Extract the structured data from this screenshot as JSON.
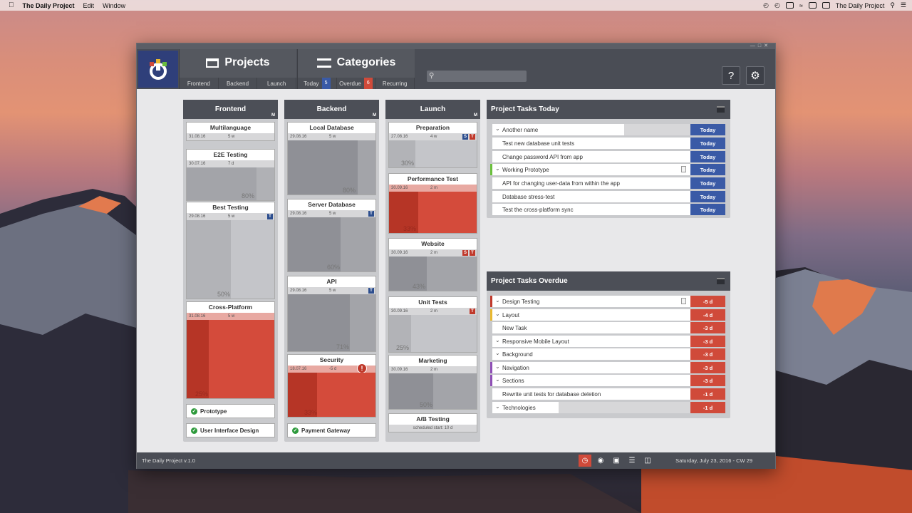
{
  "menubar": {
    "app_name": "The Daily Project",
    "menus": [
      "Edit",
      "Window"
    ],
    "right_app_name": "The Daily Project"
  },
  "topnav": {
    "projects_label": "Projects",
    "categories_label": "Categories",
    "project_tabs": [
      "Frontend",
      "Backend",
      "Launch"
    ],
    "category_tabs": [
      {
        "label": "Today",
        "badge": "5",
        "badge_color": "#3a5aa6"
      },
      {
        "label": "Overdue",
        "badge": "6",
        "badge_color": "#d04a3a"
      },
      {
        "label": "Recurring",
        "badge": "",
        "badge_color": ""
      }
    ],
    "help_label": "?",
    "search_placeholder": ""
  },
  "columns": [
    {
      "title": "Frontend",
      "corner": "M",
      "cards": [
        {
          "title": "Multilanguage",
          "date": "31.08.16",
          "dur": "5 w",
          "tags": [],
          "pct": "",
          "red": false
        },
        {
          "title": "E2E Testing",
          "date": "30.07.16",
          "dur": "7 d",
          "tags": [],
          "pct": "80%",
          "red": false
        },
        {
          "title": "Best Testing",
          "date": "29.08.16",
          "dur": "5 w",
          "tags": [
            "T"
          ],
          "pct": "50%",
          "red": false
        },
        {
          "title": "Cross-Platform",
          "date": "31.08.16",
          "dur": "5 w",
          "tags": [],
          "pct": "25%",
          "red": true
        }
      ],
      "done": [
        "Prototype",
        "User Interface Design"
      ]
    },
    {
      "title": "Backend",
      "corner": "M",
      "cards": [
        {
          "title": "Local Database",
          "date": "29.08.16",
          "dur": "5 w",
          "tags": [],
          "pct": "80%",
          "red": false
        },
        {
          "title": "Server Database",
          "date": "29.08.16",
          "dur": "5 w",
          "tags": [
            "T"
          ],
          "pct": "60%",
          "red": false
        },
        {
          "title": "API",
          "date": "29.08.16",
          "dur": "5 w",
          "tags": [
            "T"
          ],
          "pct": "71%",
          "red": false
        },
        {
          "title": "Security",
          "date": "18.07.16",
          "dur": "-5 d",
          "tags": [],
          "pct": "33%",
          "red": true
        }
      ],
      "done": [
        "Payment Gateway"
      ]
    },
    {
      "title": "Launch",
      "corner": "M",
      "cards": [
        {
          "title": "Preparation",
          "date": "27.08.16",
          "dur": "4 w",
          "tags": [
            "S",
            "T"
          ],
          "pct": "30%",
          "red": false
        },
        {
          "title": "Performance Test",
          "date": "30.09.16",
          "dur": "2 m",
          "tags": [],
          "pct": "33%",
          "red": true
        },
        {
          "title": "Website",
          "date": "30.09.16",
          "dur": "2 m",
          "tags": [
            "S",
            "T"
          ],
          "pct": "43%",
          "red": false
        },
        {
          "title": "Unit Tests",
          "date": "30.09.16",
          "dur": "2 m",
          "tags": [
            "T"
          ],
          "pct": "25%",
          "red": false
        },
        {
          "title": "Marketing",
          "date": "30.09.16",
          "dur": "2 m",
          "tags": [],
          "pct": "50%",
          "red": false
        },
        {
          "title": "A/B Testing",
          "date": "scheduled start: 10 d",
          "dur": "",
          "tags": [],
          "pct": "",
          "red": false
        }
      ],
      "done": []
    }
  ],
  "today_panel": {
    "title": "Project Tasks Today",
    "rows": [
      {
        "label": "Another name",
        "status": "Today"
      },
      {
        "label": "Test new database unit tests",
        "status": "Today"
      },
      {
        "label": "Change password API from app",
        "status": "Today"
      },
      {
        "label": "Working Prototype",
        "status": "Today"
      },
      {
        "label": "API for changing user-data from within the app",
        "status": "Today"
      },
      {
        "label": "Database stress-test",
        "status": "Today"
      },
      {
        "label": "Test the cross-platform sync",
        "status": "Today"
      }
    ]
  },
  "overdue_panel": {
    "title": "Project Tasks Overdue",
    "rows": [
      {
        "label": "Design Testing",
        "status": "-5 d"
      },
      {
        "label": "Layout",
        "status": "-4 d"
      },
      {
        "label": "New Task",
        "status": "-3 d"
      },
      {
        "label": "Responsive Mobile Layout",
        "status": "-3 d"
      },
      {
        "label": "Background",
        "status": "-3 d"
      },
      {
        "label": "Navigation",
        "status": "-3 d"
      },
      {
        "label": "Sections",
        "status": "-3 d"
      },
      {
        "label": "Rewrite unit tests for database deletion",
        "status": "-1 d"
      },
      {
        "label": "Technologies",
        "status": "-1 d"
      }
    ]
  },
  "footer": {
    "version": "The Daily Project v.1.0",
    "date": "Saturday, July 23, 2016 - CW 29"
  },
  "colors": {
    "today": "#3a5aa6",
    "overdue": "#d04a3a",
    "done": "#2e9a3c",
    "accent_green": "#6abf3c",
    "accent_yellow": "#e8b830",
    "accent_purple": "#8e4fb5",
    "accent_red": "#c0392b"
  }
}
